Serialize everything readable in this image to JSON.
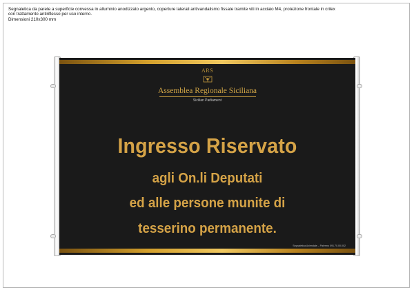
{
  "spec": {
    "lines": [
      "Segnaletica da parete a superficie convessa in alluminio anodizzato argento, coperture laterali antivandalismo fissate tramite viti in acciaio M4, protezione frontale in crilex",
      "con trattamento antiriflesso per uso interno.",
      "Dimensioni 210x300 mm"
    ]
  },
  "sign": {
    "logo_abbr": "ARS",
    "logo_name": "Assemblea Regionale Siciliana",
    "logo_sub": "Sicilian Parliament",
    "title": "Ingresso Riservato",
    "lines": [
      "agli On.li Deputati",
      "ed alle persone munite di",
      "tesserino permanente."
    ],
    "footer_note": "Segnaletica Aziendale – Palermo 091.70.00.002"
  },
  "colors": {
    "sign_background": "#1a1a1a",
    "gold_text": "#d5a347",
    "gold_bar": "#d4a02c",
    "rail_silver": "#e4e4e4"
  }
}
